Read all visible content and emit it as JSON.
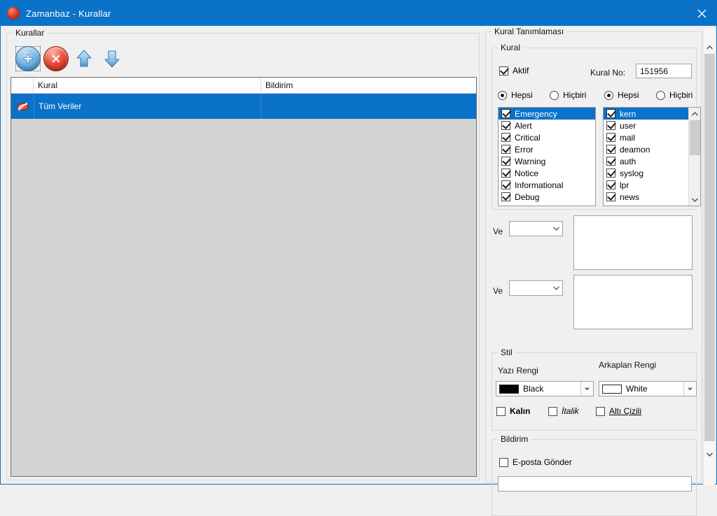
{
  "window": {
    "title": "Zamanbaz - Kurallar",
    "app_icon": "red-circle-icon",
    "close_label": "close-icon"
  },
  "left": {
    "group_title": "Kurallar",
    "toolbar": [
      {
        "name": "add-rule-button",
        "icon": "plus-circle-icon",
        "focused": true
      },
      {
        "name": "delete-rule-button",
        "icon": "delete-circle-icon",
        "focused": false
      },
      {
        "name": "move-up-button",
        "icon": "arrow-up-icon",
        "focused": false
      },
      {
        "name": "move-down-button",
        "icon": "arrow-down-icon",
        "focused": false
      }
    ],
    "list": {
      "columns": [
        "Kural",
        "Bildirim"
      ],
      "rows": [
        {
          "icon": "rule-icon",
          "kural": "Tüm Veriler",
          "bildirim": "",
          "selected": true
        }
      ]
    }
  },
  "right": {
    "group_title": "Kural Tanımlaması",
    "rule": {
      "group_title": "Kural",
      "active_label": "Aktif",
      "active_checked": true,
      "rule_no_label": "Kural No:",
      "rule_no_value": "151956",
      "severity_radio": {
        "all_label": "Hepsi",
        "none_label": "Hiçbiri",
        "selected": "Hepsi"
      },
      "facility_radio": {
        "all_label": "Hepsi",
        "none_label": "Hiçbiri",
        "selected": "Hepsi"
      },
      "severity_items": [
        {
          "label": "Emergency",
          "checked": true,
          "selected": true
        },
        {
          "label": "Alert",
          "checked": true,
          "selected": false
        },
        {
          "label": "Critical",
          "checked": true,
          "selected": false
        },
        {
          "label": "Error",
          "checked": true,
          "selected": false
        },
        {
          "label": "Warning",
          "checked": true,
          "selected": false
        },
        {
          "label": "Notice",
          "checked": true,
          "selected": false
        },
        {
          "label": "Informational",
          "checked": true,
          "selected": false
        },
        {
          "label": "Debug",
          "checked": true,
          "selected": false
        }
      ],
      "facility_items": [
        {
          "label": "kern",
          "checked": true,
          "selected": true
        },
        {
          "label": "user",
          "checked": true,
          "selected": false
        },
        {
          "label": "mail",
          "checked": true,
          "selected": false
        },
        {
          "label": "deamon",
          "checked": true,
          "selected": false
        },
        {
          "label": "auth",
          "checked": true,
          "selected": false
        },
        {
          "label": "syslog",
          "checked": true,
          "selected": false
        },
        {
          "label": "lpr",
          "checked": true,
          "selected": false
        },
        {
          "label": "news",
          "checked": true,
          "selected": false
        }
      ]
    },
    "conditions": [
      {
        "prefix_label": "Ve",
        "operator_value": "",
        "text_value": ""
      },
      {
        "prefix_label": "Ve",
        "operator_value": "",
        "text_value": ""
      }
    ],
    "style": {
      "group_title": "Stil",
      "text_color_label": "Yazı Rengi",
      "text_color_value": "Black",
      "text_color_hex": "#000000",
      "bg_color_label": "Arkaplan Rengi",
      "bg_color_value": "White",
      "bg_color_hex": "#ffffff",
      "bold_label": "Kalın",
      "bold_checked": false,
      "italic_label": "İtalik",
      "italic_checked": false,
      "underline_label": "Altı Çizili",
      "underline_checked": false
    },
    "notification": {
      "group_title": "Bildirim",
      "email_label": "E-posta Gönder",
      "email_checked": false,
      "email_value": ""
    }
  },
  "colors": {
    "accent": "#0b72c9",
    "titlebar": "#0a73c8",
    "window_bg": "#f0f0f0",
    "list_bg": "#d4d4d4"
  }
}
